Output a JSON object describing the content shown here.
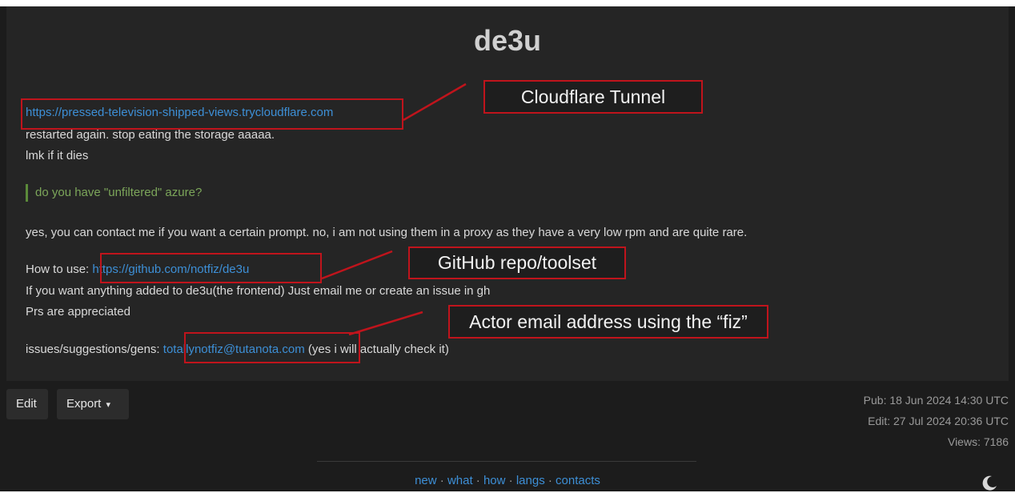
{
  "paste": {
    "title": "de3u",
    "url_link": "https://pressed-television-shipped-views.trycloudflare.com",
    "line_restarted": "restarted again. stop eating the storage aaaaa.",
    "line_lmk": "lmk if it dies",
    "quote": "do you have \"unfiltered\" azure?",
    "line_yes": "yes, you can contact me if you want a certain prompt. no, i am not using them in a proxy as they have a very low rpm and are quite rare.",
    "how_prefix": "How to use: ",
    "github_link": "https://github.com/notfiz/de3u",
    "line_added": "If you want anything added to de3u(the frontend) Just email me or create an issue in gh",
    "line_prs": "Prs are appreciated",
    "issues_prefix": "issues/suggestions/gens: ",
    "email_link": "totallynotfiz@tutanota.com",
    "issues_suffix": " (yes i will actually check it)"
  },
  "annotations": {
    "cloudflare": "Cloudflare Tunnel",
    "github": "GitHub repo/toolset",
    "email": "Actor email address using the “fiz”",
    "color": "#c0141c"
  },
  "toolbar": {
    "edit_label": "Edit",
    "export_label": "Export",
    "export_caret": "▾"
  },
  "meta": {
    "pub": "Pub: 18 Jun 2024 14:30 UTC",
    "edit": "Edit: 27 Jul 2024 20:36 UTC",
    "views": "Views: 7186"
  },
  "footer": {
    "links": [
      "new",
      "what",
      "how",
      "langs",
      "contacts"
    ],
    "separator": " · "
  },
  "icons": {
    "theme_toggle": "moon-icon"
  },
  "colors": {
    "link": "#3d8fd6",
    "quote": "#7ca65a",
    "background": "#1c1c1c"
  }
}
